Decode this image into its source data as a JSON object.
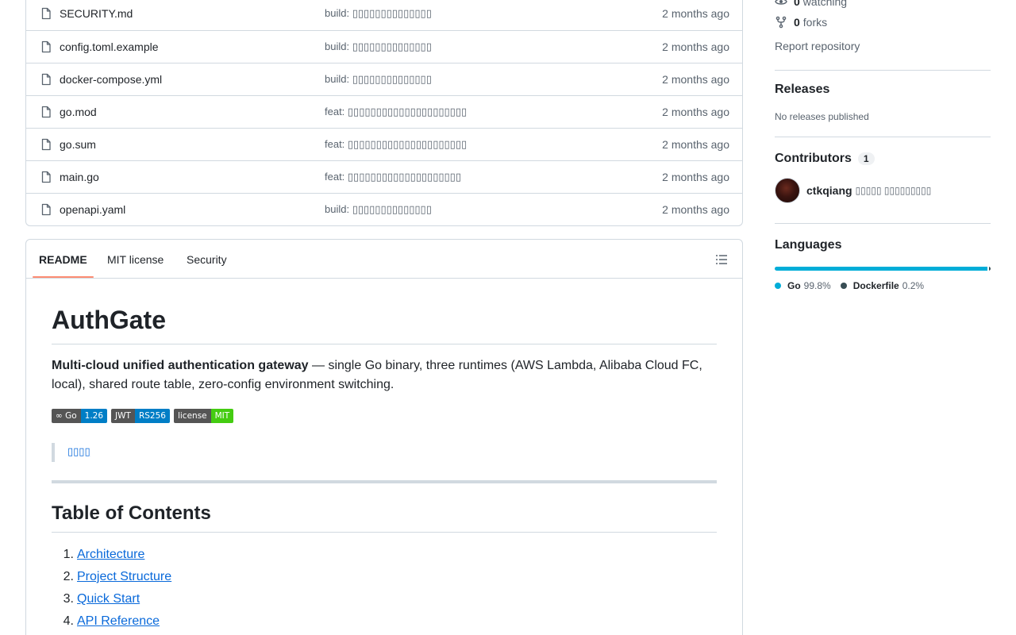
{
  "files": [
    {
      "name": "SECURITY.md",
      "message": "build: ▯▯▯▯▯▯▯▯▯▯▯▯▯▯",
      "time": "2 months ago"
    },
    {
      "name": "config.toml.example",
      "message": "build: ▯▯▯▯▯▯▯▯▯▯▯▯▯▯",
      "time": "2 months ago"
    },
    {
      "name": "docker-compose.yml",
      "message": "build: ▯▯▯▯▯▯▯▯▯▯▯▯▯▯",
      "time": "2 months ago"
    },
    {
      "name": "go.mod",
      "message": "feat: ▯▯▯▯▯▯▯▯▯▯▯▯▯▯▯▯▯▯▯▯▯",
      "time": "2 months ago"
    },
    {
      "name": "go.sum",
      "message": "feat: ▯▯▯▯▯▯▯▯▯▯▯▯▯▯▯▯▯▯▯▯▯",
      "time": "2 months ago"
    },
    {
      "name": "main.go",
      "message": "feat: ▯▯▯▯▯▯▯▯▯▯▯▯▯▯▯▯▯▯▯▯",
      "time": "2 months ago"
    },
    {
      "name": "openapi.yaml",
      "message": "build: ▯▯▯▯▯▯▯▯▯▯▯▯▯▯",
      "time": "2 months ago"
    }
  ],
  "readme": {
    "tabs": [
      "README",
      "MIT license",
      "Security"
    ],
    "title": "AuthGate",
    "intro_bold": "Multi-cloud unified authentication gateway",
    "intro_rest": " — single Go binary, three runtimes (AWS Lambda, Alibaba Cloud FC, local), shared route table, zero-config environment switching.",
    "badges": [
      {
        "label": "∞ Go",
        "value": "1.26",
        "color": "#007ec6"
      },
      {
        "label": "JWT",
        "value": "RS256",
        "color": "#007ec6"
      },
      {
        "label": "license",
        "value": "MIT",
        "color": "#4c1"
      }
    ],
    "quote_link": "▯▯▯▯",
    "toc_title": "Table of Contents",
    "toc": [
      {
        "num": "1.",
        "label": "Architecture"
      },
      {
        "num": "2.",
        "label": "Project Structure"
      },
      {
        "num": "3.",
        "label": "Quick Start"
      },
      {
        "num": "4.",
        "label": "API Reference"
      }
    ]
  },
  "sidebar": {
    "watching_count": "0",
    "watching_label": "watching",
    "forks_count": "0",
    "forks_label": "forks",
    "report": "Report repository",
    "releases_title": "Releases",
    "releases_empty": "No releases published",
    "contributors_title": "Contributors",
    "contributors_count": "1",
    "contributor_name": "ctkqiang",
    "contributor_sub": "▯▯▯▯▯ ▯▯▯▯▯▯▯▯▯",
    "languages_title": "Languages",
    "languages": [
      {
        "name": "Go",
        "pct": "99.8%",
        "share": 99.8,
        "color": "#00add8"
      },
      {
        "name": "Dockerfile",
        "pct": "0.2%",
        "share": 0.2,
        "color": "#384d54"
      }
    ]
  }
}
